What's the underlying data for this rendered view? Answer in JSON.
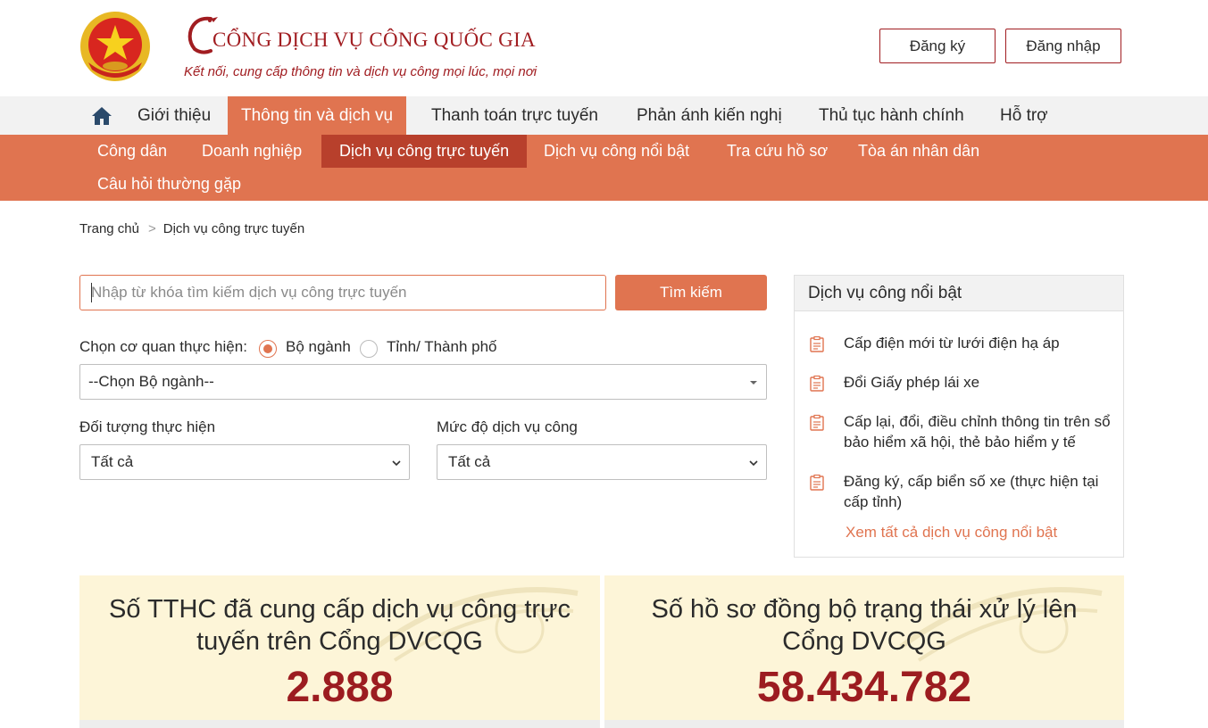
{
  "header": {
    "title": "CỔNG DỊCH VỤ CÔNG QUỐC GIA",
    "tagline": "Kết nối, cung cấp thông tin và dịch vụ công mọi lúc, mọi nơi",
    "register_label": "Đăng ký",
    "login_label": "Đăng nhập"
  },
  "main_nav": {
    "items": [
      {
        "label": "Giới thiệu"
      },
      {
        "label": "Thông tin và dịch vụ"
      },
      {
        "label": "Thanh toán trực tuyến"
      },
      {
        "label": "Phản ánh kiến nghị"
      },
      {
        "label": "Thủ tục hành chính"
      },
      {
        "label": "Hỗ trợ"
      }
    ],
    "active_index": 1
  },
  "sub_nav": {
    "items": [
      {
        "label": "Công dân"
      },
      {
        "label": "Doanh nghiệp"
      },
      {
        "label": "Dịch vụ công trực tuyến"
      },
      {
        "label": "Dịch vụ công nổi bật"
      },
      {
        "label": "Tra cứu hồ sơ"
      },
      {
        "label": "Tòa án nhân dân"
      },
      {
        "label": "Câu hỏi thường gặp"
      }
    ],
    "active_index": 2
  },
  "breadcrumb": {
    "home": "Trang chủ",
    "separator": ">",
    "current": "Dịch vụ công trực tuyến"
  },
  "search": {
    "placeholder": "Nhập từ khóa tìm kiếm dịch vụ công trực tuyến",
    "button_label": "Tìm kiếm"
  },
  "agency": {
    "label": "Chọn cơ quan thực hiện:",
    "options": [
      "Bộ ngành",
      "Tỉnh/ Thành phố"
    ],
    "selected": "Bộ ngành",
    "select_value": "--Chọn Bộ ngành--"
  },
  "filters": {
    "subject_label": "Đối tượng thực hiện",
    "subject_value": "Tất cả",
    "level_label": "Mức độ dịch vụ công",
    "level_value": "Tất cả"
  },
  "featured": {
    "title": "Dịch vụ công nổi bật",
    "items": [
      {
        "label": "Cấp điện mới từ lưới điện hạ áp"
      },
      {
        "label": "Đổi Giấy phép lái xe"
      },
      {
        "label": "Cấp lại, đổi, điều chỉnh thông tin trên sổ bảo hiểm xã hội, thẻ bảo hiểm y tế"
      },
      {
        "label": "Đăng ký, cấp biển số xe (thực hiện tại cấp tỉnh)"
      }
    ],
    "view_all": "Xem tất cả dịch vụ công nổi bật"
  },
  "stats": [
    {
      "title": "Số TTHC đã cung cấp dịch vụ công trực tuyến trên Cổng DVCQG",
      "value": "2.888"
    },
    {
      "title": "Số hồ sơ đồng bộ trạng thái xử lý lên Cổng DVCQG",
      "value": "58.434.782"
    }
  ],
  "colors": {
    "brand_red": "#a11d21",
    "accent_orange": "#e07450",
    "active_sub": "#b8402c",
    "stat_bg": "#fdf5d8"
  }
}
